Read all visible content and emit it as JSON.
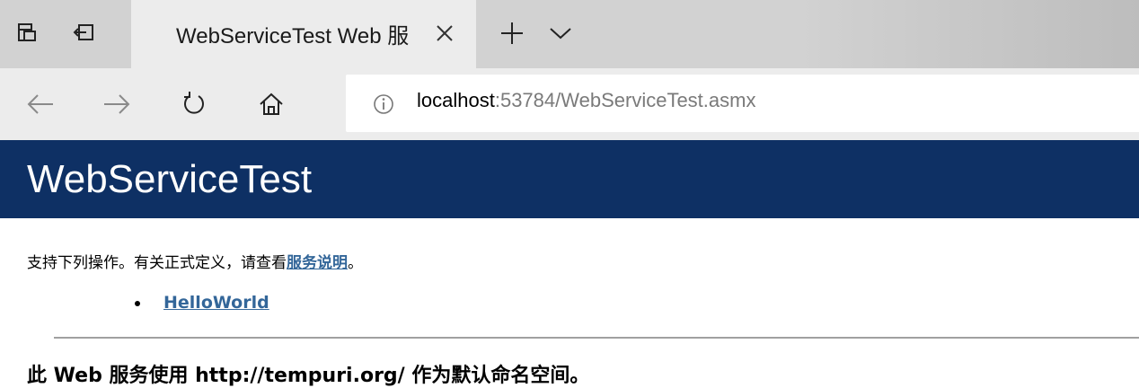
{
  "browser": {
    "tab": {
      "title": "WebServiceTest Web 服",
      "close_icon": "close-icon"
    },
    "tab_controls": {
      "set_aside_icon": "tabs-aside-icon",
      "restore_icon": "tabs-restore-icon",
      "new_tab_icon": "plus-icon",
      "tab_list_icon": "chevron-down-icon"
    },
    "nav": {
      "back_icon": "arrow-left-icon",
      "forward_icon": "arrow-right-icon",
      "refresh_icon": "refresh-icon",
      "home_icon": "home-icon"
    },
    "address": {
      "info_icon": "info-icon",
      "host": "localhost",
      "rest": ":53784/WebServiceTest.asmx"
    }
  },
  "page": {
    "title": "WebServiceTest",
    "intro_text": "支持下列操作。有关正式定义，请查看",
    "intro_link": "服务说明",
    "intro_end": "。",
    "operations": [
      "HelloWorld"
    ],
    "namespace_heading": "此 Web 服务使用 http://tempuri.org/ 作为默认命名空间。"
  },
  "colors": {
    "banner": "#0e3064",
    "link": "#336699",
    "chrome": "#ececec"
  }
}
